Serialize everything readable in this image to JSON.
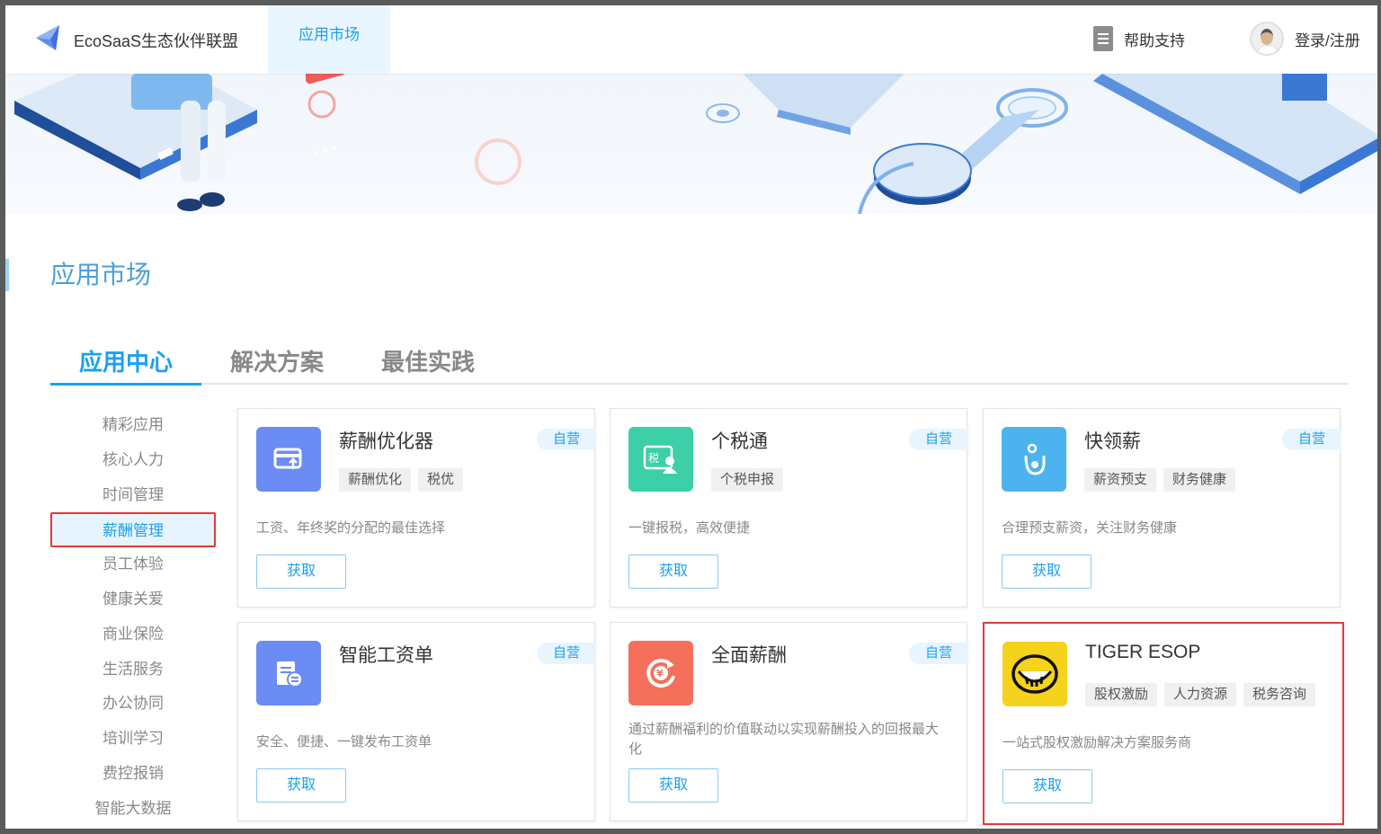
{
  "header": {
    "brand": "EcoSaaS生态伙伴联盟",
    "nav_tab": "应用市场",
    "help": "帮助支持",
    "login": "登录/注册"
  },
  "page": {
    "title": "应用市场"
  },
  "main_tabs": [
    "应用中心",
    "解决方案",
    "最佳实践"
  ],
  "sidebar": {
    "items": [
      "精彩应用",
      "核心人力",
      "时间管理",
      "薪酬管理",
      "员工体验",
      "健康关爱",
      "商业保险",
      "生活服务",
      "办公协同",
      "培训学习",
      "费控报销",
      "智能大数据"
    ],
    "active": "薪酬管理"
  },
  "cards": [
    {
      "title": "薪酬优化器",
      "badge": "自营",
      "tags": [
        "薪酬优化",
        "税优"
      ],
      "desc": "工资、年终奖的分配的最佳选择",
      "button": "获取",
      "icon": "salary-optimizer-icon",
      "color": "#6b8cf2"
    },
    {
      "title": "个税通",
      "badge": "自营",
      "tags": [
        "个税申报"
      ],
      "desc": "一键报税，高效便捷",
      "button": "获取",
      "icon": "tax-icon",
      "color": "#3ccfa8"
    },
    {
      "title": "快领薪",
      "badge": "自营",
      "tags": [
        "薪资预支",
        "财务健康"
      ],
      "desc": "合理预支薪资，关注财务健康",
      "button": "获取",
      "icon": "hand-coin-icon",
      "color": "#4db3ee"
    },
    {
      "title": "智能工资单",
      "badge": "自营",
      "tags": [],
      "desc": "安全、便捷、一键发布工资单",
      "button": "获取",
      "icon": "payslip-icon",
      "color": "#6b8cf2"
    },
    {
      "title": "全面薪酬",
      "badge": "自营",
      "tags": [],
      "desc": "通过薪酬福利的价值联动以实现薪酬投入的回报最大化",
      "button": "获取",
      "icon": "yen-cycle-icon",
      "color": "#f4705b"
    },
    {
      "title": "TIGER ESOP",
      "badge": "",
      "tags": [
        "股权激励",
        "人力资源",
        "税务咨询"
      ],
      "desc": "一站式股权激励解决方案服务商",
      "button": "获取",
      "icon": "tiger-logo-icon",
      "color": "#f5d21c"
    }
  ]
}
